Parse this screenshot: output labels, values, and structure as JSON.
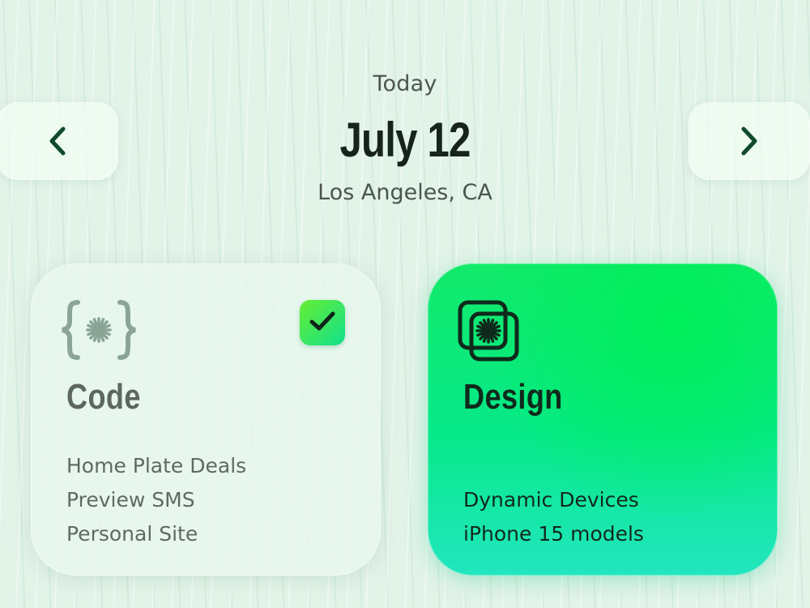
{
  "header": {
    "today_label": "Today",
    "date": "July 12",
    "location": "Los Angeles, CA"
  },
  "navigation": {
    "prev_icon": "chevron-left-icon",
    "next_icon": "chevron-right-icon",
    "chevron_color": "#0f4a2a"
  },
  "cards": [
    {
      "title": "Code",
      "icon": "curly-braces-asterisk-icon",
      "checked": true,
      "items": [
        "Home Plate Deals",
        "Preview SMS",
        "Personal Site"
      ]
    },
    {
      "title": "Design",
      "icon": "stacked-squares-asterisk-icon",
      "items": [
        "Dynamic Devices",
        "iPhone 15 models"
      ]
    }
  ],
  "colors": {
    "background": "#e2f3e8",
    "accent_green": "#12ea6a",
    "accent_teal": "#22e6bf",
    "title_dark": "#16241d"
  }
}
